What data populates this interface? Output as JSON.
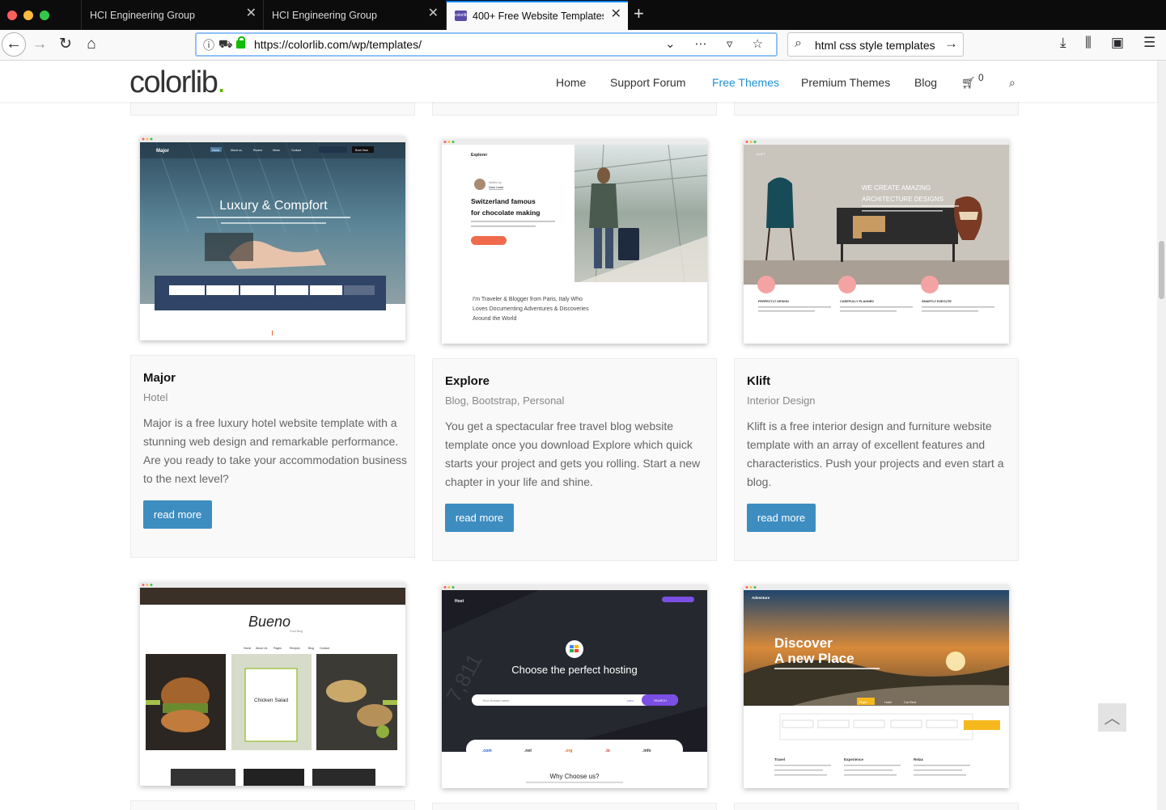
{
  "browser": {
    "tabs": [
      {
        "title": "HCI Engineering Group"
      },
      {
        "title": "HCI Engineering Group"
      },
      {
        "title": "400+ Free Website Templates",
        "favicon": "colorlib"
      }
    ],
    "url": "https://colorlib.com/wp/templates/",
    "search_query": "html css style templates"
  },
  "site": {
    "logo_text": "colorlib",
    "logo_dot": ".",
    "menu": [
      {
        "label": "Home"
      },
      {
        "label": "Support Forum"
      },
      {
        "label": "Free Themes",
        "active": true
      },
      {
        "label": "Premium Themes"
      },
      {
        "label": "Blog"
      }
    ],
    "cart_count": "0"
  },
  "cards": [
    {
      "title": "Major",
      "category": "Hotel",
      "description": "Major is a free luxury hotel website template with a stunning web design and remarkable performance. Are you ready to take your accommodation business to the next level?",
      "button": "read more",
      "preview": {
        "brand": "Major",
        "headline": "Luxury & Compfort",
        "nav": [
          "Home",
          "About us",
          "Rooms",
          "News",
          "Contact"
        ],
        "cta": "Book Now"
      }
    },
    {
      "title": "Explore",
      "category": "Blog, Bootstrap, Personal",
      "description": "You get a spectacular free travel blog website template once you download Explore which quick starts your project and gets you rolling. Start a new chapter in your life and shine.",
      "button": "read more",
      "preview": {
        "brand": "Explorer",
        "author": "Dave Lewis",
        "headline1": "Switzerland famous",
        "headline2": "for chocolate making",
        "intro1": "I'm Traveler & Blogger from Paris, Italy Who",
        "intro2": "Loves Documenting Adventures & Discoveries",
        "intro3": "Around the World"
      }
    },
    {
      "title": "Klift",
      "category": "Interior Design",
      "description": "Klift is a free interior design and furniture website template with an array of excellent features and characteristics. Push your projects and even start a blog.",
      "button": "read more",
      "preview": {
        "brand": "KLIFT",
        "headline1": "WE CREATE AMAZING",
        "headline2": "ARCHITECTURE DESIGNS",
        "features": [
          "PERFECTLY DESIGN",
          "CAREFULLY PLANNED",
          "SMARTLY EXECUTE"
        ]
      }
    },
    {
      "preview": {
        "brand": "Bueno",
        "sub": "Food Blog",
        "dish": "Chicken Salad",
        "nav": [
          "Home",
          "About Us",
          "Pages",
          "Recipes",
          "Blog",
          "Contact"
        ]
      }
    },
    {
      "preview": {
        "brand": "Host",
        "headline": "Choose the perfect hosting",
        "placeholder": "Your domain name",
        "search": "SEARCH",
        "tlds": [
          ".com",
          ".net",
          ".org",
          ".io",
          ".info"
        ],
        "why": "Why Choose us?"
      }
    },
    {
      "preview": {
        "brand": "Adventure",
        "headline1": "Discover",
        "headline2": "A new Place",
        "tabs": [
          "Flight",
          "Hotel",
          "Car Rent"
        ],
        "items": [
          "Travel",
          "Experience",
          "Relax"
        ]
      }
    }
  ],
  "icons": {
    "back": "back-arrow-icon",
    "forward": "forward-arrow-icon",
    "reload": "reload-icon",
    "home": "home-icon",
    "cart": "cart-icon",
    "search": "search-icon",
    "back_to_top": "chevron-up-icon"
  },
  "colors": {
    "accent": "#1e90d8",
    "button": "#3d8dc1",
    "logo_dot": "#5fb700"
  }
}
